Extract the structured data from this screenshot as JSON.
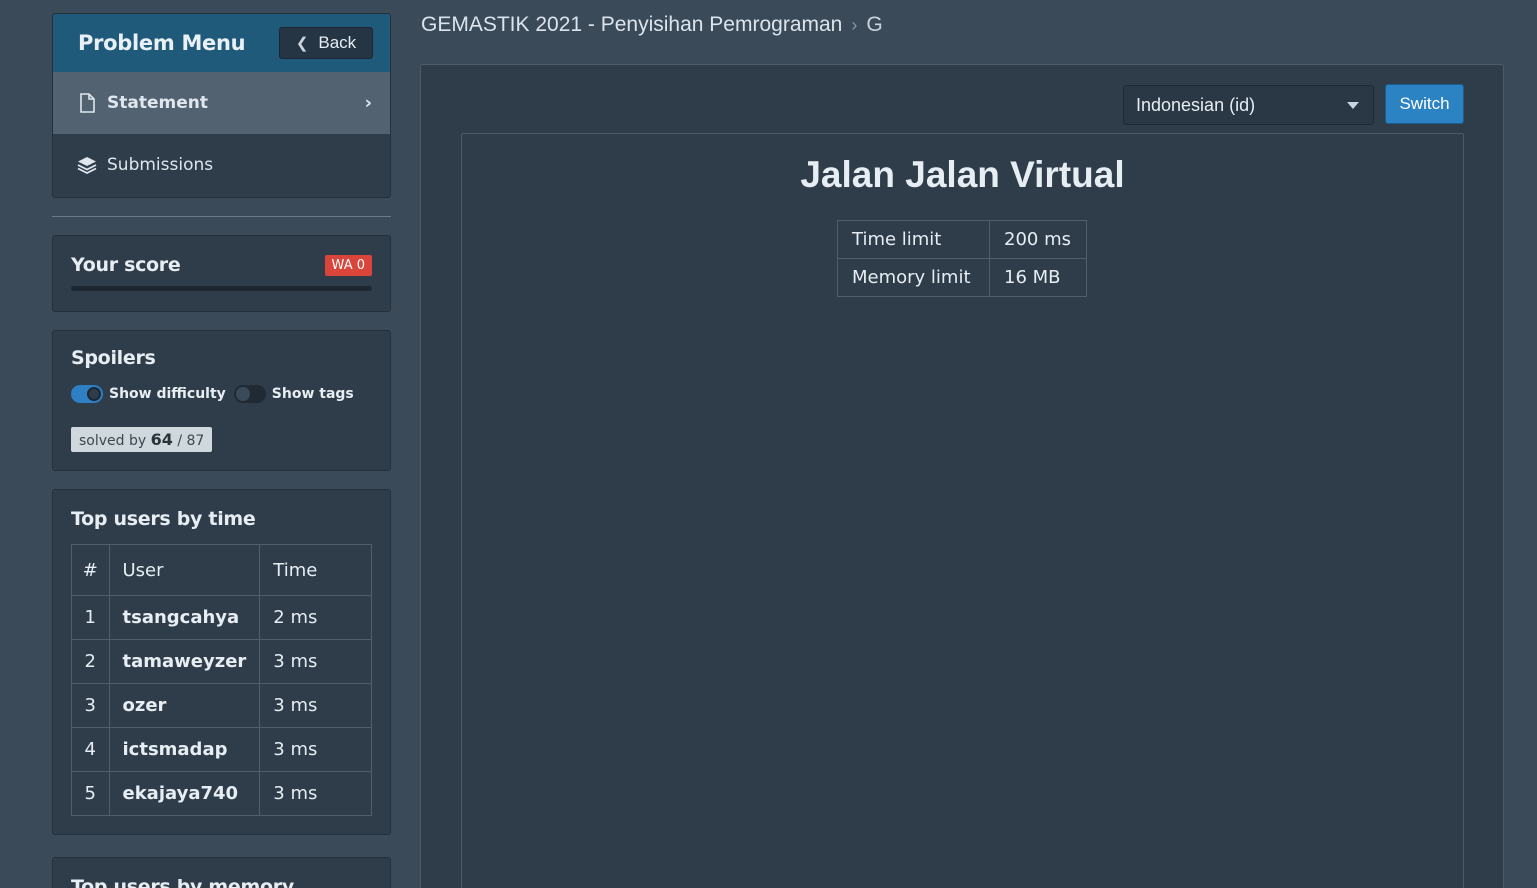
{
  "sidebar": {
    "menu_title": "Problem Menu",
    "back_label": "Back",
    "items": [
      {
        "label": "Statement",
        "icon": "file-icon",
        "active": true
      },
      {
        "label": "Submissions",
        "icon": "layers-icon",
        "active": false
      }
    ],
    "score": {
      "title": "Your score",
      "badge": "WA 0",
      "badge_color": "#d9443b"
    },
    "spoilers": {
      "title": "Spoilers",
      "show_difficulty": {
        "label": "Show difficulty",
        "on": true
      },
      "show_tags": {
        "label": "Show tags",
        "on": false
      },
      "solved_prefix": "solved by",
      "solved_count": "64",
      "solved_total": "/ 87"
    },
    "top_time": {
      "title": "Top users by time",
      "headers": [
        "#",
        "User",
        "Time"
      ],
      "rows": [
        {
          "rank": "1",
          "user": "tsangcahya",
          "time": "2 ms"
        },
        {
          "rank": "2",
          "user": "tamaweyzer",
          "time": "3 ms"
        },
        {
          "rank": "3",
          "user": "ozer",
          "time": "3 ms"
        },
        {
          "rank": "4",
          "user": "ictsmadap",
          "time": "3 ms"
        },
        {
          "rank": "5",
          "user": "ekajaya740",
          "time": "3 ms"
        }
      ]
    },
    "top_memory": {
      "title": "Top users by memory"
    }
  },
  "breadcrumb": {
    "contest": "GEMASTIK 2021 - Penyisihan Pemrograman",
    "current": "G"
  },
  "main": {
    "language": "Indonesian (id)",
    "switch_label": "Switch",
    "problem_title": "Jalan Jalan Virtual",
    "limits": [
      {
        "label": "Time limit",
        "value": "200 ms"
      },
      {
        "label": "Memory limit",
        "value": "16 MB"
      }
    ]
  },
  "colors": {
    "accent": "#2c83c4",
    "header": "#1f5a7a",
    "background": "#3a4a59"
  }
}
